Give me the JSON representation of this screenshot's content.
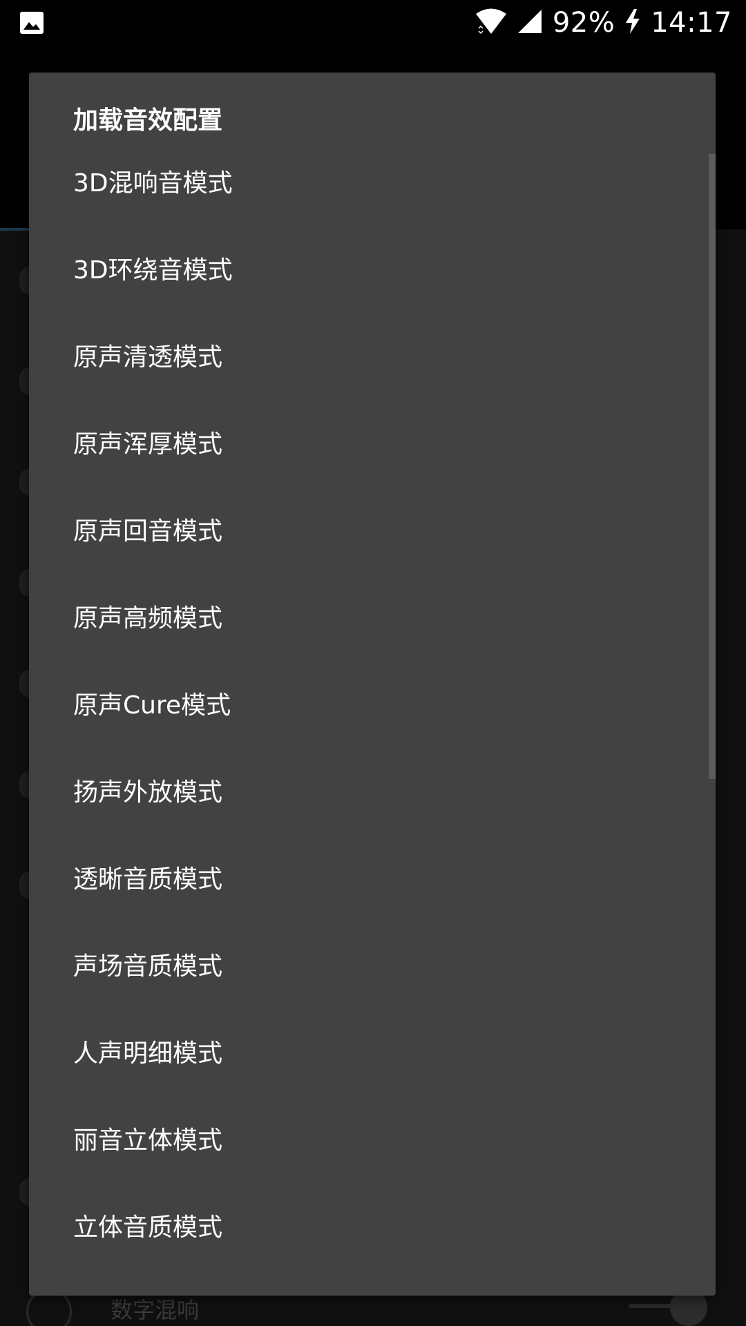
{
  "status_bar": {
    "left_icon": "image-icon",
    "wifi_icon": "wifi-icon",
    "signal_icon": "signal-icon",
    "battery_percent": "92%",
    "charging_icon": "bolt-icon",
    "time": "14:17"
  },
  "background": {
    "bottom_label": "数字混响"
  },
  "dialog": {
    "title": "加载音效配置",
    "items": [
      {
        "label": "3D混响音模式"
      },
      {
        "label": "3D环绕音模式"
      },
      {
        "label": "原声清透模式"
      },
      {
        "label": "原声浑厚模式"
      },
      {
        "label": "原声回音模式"
      },
      {
        "label": "原声高频模式"
      },
      {
        "label": "原声Cure模式"
      },
      {
        "label": "扬声外放模式"
      },
      {
        "label": "透晰音质模式"
      },
      {
        "label": "声场音质模式"
      },
      {
        "label": "人声明细模式"
      },
      {
        "label": "丽音立体模式"
      },
      {
        "label": "立体音质模式"
      }
    ]
  },
  "colors": {
    "dialog_bg": "#424242",
    "text": "#ffffff",
    "status_bar_bg": "#000000"
  }
}
